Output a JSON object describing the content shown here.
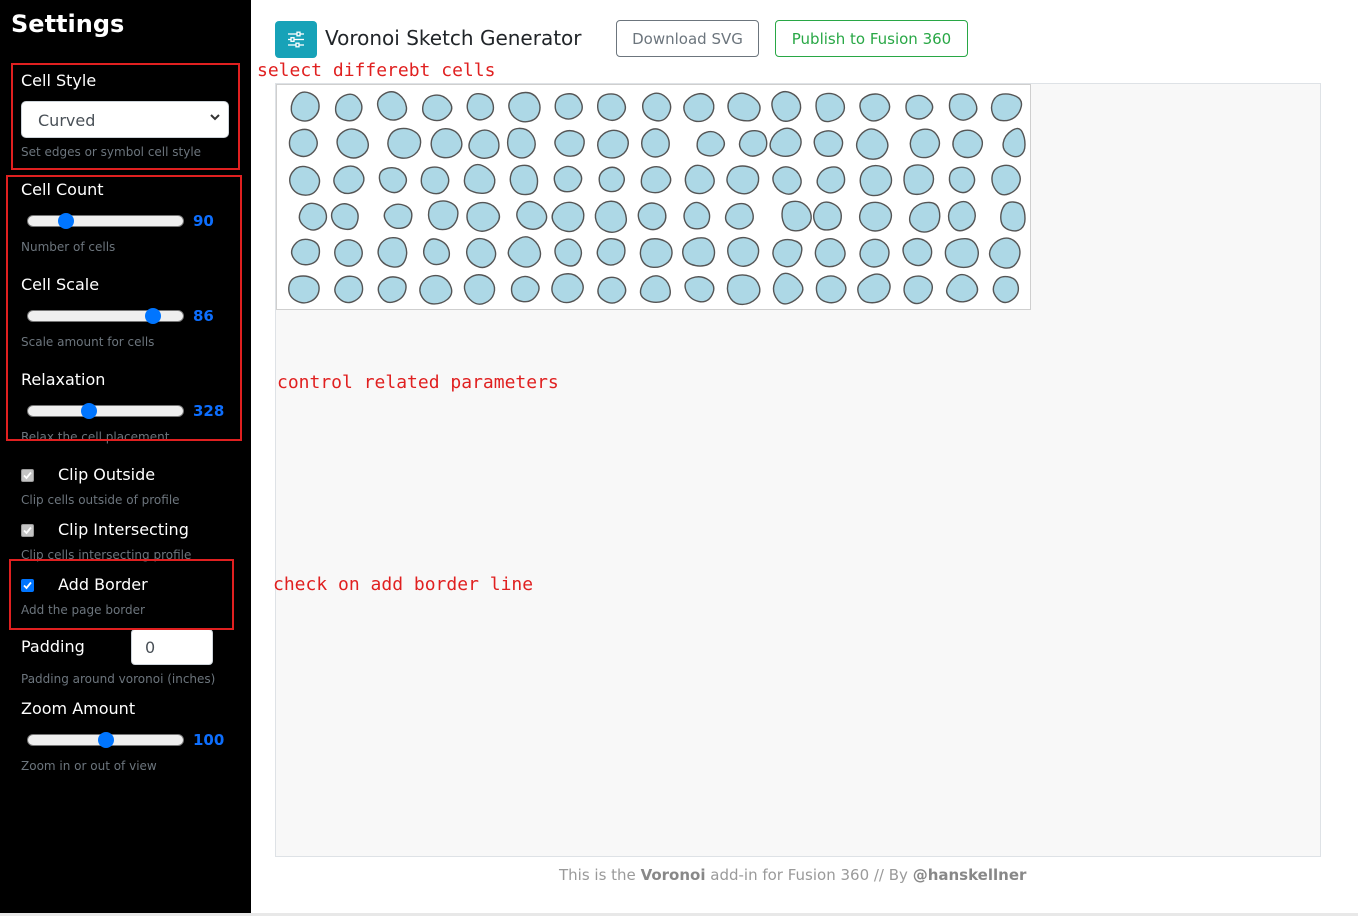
{
  "sidebar": {
    "title": "Settings",
    "cell_style": {
      "label": "Cell Style",
      "selected": "Curved",
      "help": "Set edges or symbol cell style"
    },
    "cell_count": {
      "label": "Cell Count",
      "value": "90",
      "help": "Number of cells",
      "fraction": 0.22
    },
    "cell_scale": {
      "label": "Cell Scale",
      "value": "86",
      "help": "Scale amount for cells",
      "fraction": 0.84
    },
    "relaxation": {
      "label": "Relaxation",
      "value": "328",
      "help": "Relax the cell placement",
      "fraction": 0.38
    },
    "clip_outside": {
      "label": "Clip Outside",
      "help": "Clip cells outside of profile",
      "checked": true,
      "disabled": true
    },
    "clip_intersecting": {
      "label": "Clip Intersecting",
      "help": "Clip cells intersecting profile",
      "checked": true,
      "disabled": true
    },
    "add_border": {
      "label": "Add Border",
      "help": "Add the page border",
      "checked": true
    },
    "padding": {
      "label": "Padding",
      "value": "0",
      "help": "Padding around voronoi (inches)"
    },
    "zoom": {
      "label": "Zoom Amount",
      "value": "100",
      "help": "Zoom in or out of view",
      "fraction": 0.5
    }
  },
  "header": {
    "app_icon": "sliders-icon",
    "title": "Voronoi Sketch Generator",
    "download_label": "Download SVG",
    "publish_label": "Publish to Fusion 360"
  },
  "annotations": {
    "cells": "select differebt cells",
    "params": "control related parameters",
    "border": "check on add border line"
  },
  "footer": {
    "prefix": "This is the ",
    "product": "Voronoi",
    "middle": " add-in for Fusion 360 // By ",
    "author": "@hanskellner"
  },
  "colors": {
    "accent": "#0075ff",
    "cell_fill": "#add8e6",
    "cell_stroke": "#555555",
    "annotation": "#e02020",
    "logo_bg": "#17a2b8",
    "publish": "#28a745"
  }
}
